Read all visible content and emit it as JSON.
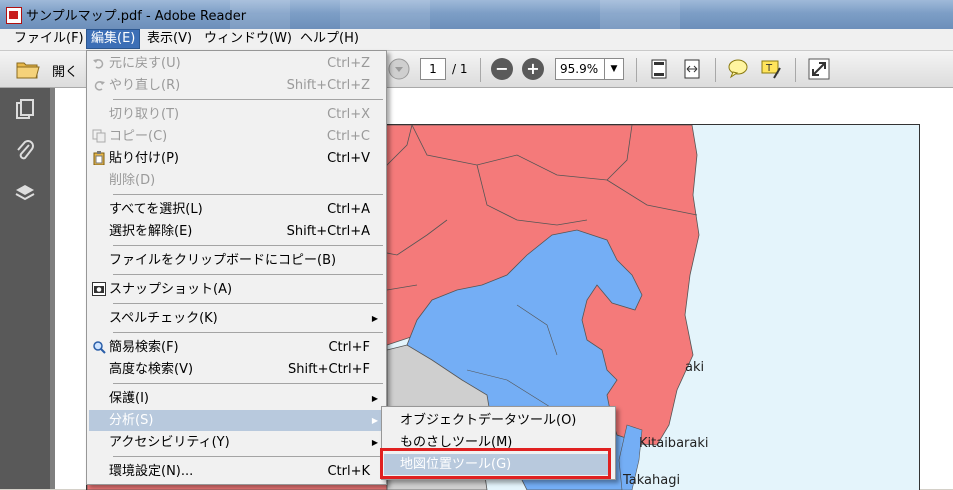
{
  "window": {
    "title": "サンプルマップ.pdf - Adobe Reader"
  },
  "menubar": [
    {
      "label": "ファイル(F)"
    },
    {
      "label": "編集(E)"
    },
    {
      "label": "表示(V)"
    },
    {
      "label": "ウィンドウ(W)"
    },
    {
      "label": "ヘルプ(H)"
    }
  ],
  "toolbar": {
    "open_label": "開く",
    "page_current": "1",
    "page_total": "/ 1",
    "zoom_value": "95.9%"
  },
  "edit_menu": {
    "items": [
      {
        "label": "元に戻す(U)",
        "shortcut": "Ctrl+Z"
      },
      {
        "label": "やり直し(R)",
        "shortcut": "Shift+Ctrl+Z"
      },
      {
        "label": "切り取り(T)",
        "shortcut": "Ctrl+X"
      },
      {
        "label": "コピー(C)",
        "shortcut": "Ctrl+C"
      },
      {
        "label": "貼り付け(P)",
        "shortcut": "Ctrl+V"
      },
      {
        "label": "削除(D)",
        "shortcut": ""
      },
      {
        "label": "すべてを選択(L)",
        "shortcut": "Ctrl+A"
      },
      {
        "label": "選択を解除(E)",
        "shortcut": "Shift+Ctrl+A"
      },
      {
        "label": "ファイルをクリップボードにコピー(B)",
        "shortcut": ""
      },
      {
        "label": "スナップショット(A)",
        "shortcut": ""
      },
      {
        "label": "スペルチェック(K)",
        "shortcut": ""
      },
      {
        "label": "簡易検索(F)",
        "shortcut": "Ctrl+F"
      },
      {
        "label": "高度な検索(V)",
        "shortcut": "Shift+Ctrl+F"
      },
      {
        "label": "保護(I)",
        "shortcut": ""
      },
      {
        "label": "分析(S)",
        "shortcut": ""
      },
      {
        "label": "アクセシビリティ(Y)",
        "shortcut": ""
      },
      {
        "label": "環境設定(N)...",
        "shortcut": "Ctrl+K"
      }
    ]
  },
  "analysis_submenu": {
    "items": [
      {
        "label": "オブジェクトデータツール(O)"
      },
      {
        "label": "ものさしツール(M)"
      },
      {
        "label": "地図位置ツール(G)"
      }
    ]
  },
  "map": {
    "labels": [
      "aki",
      "Kitaibaraki",
      "Takahagi"
    ]
  },
  "colors": {
    "menu_active": "#3d6fb6",
    "menu_highlight": "#b8c9dd",
    "map_red": "#f47a7a",
    "map_blue": "#74aef5",
    "map_gray": "#cfcfcf",
    "sea": "#e4f4fb",
    "callout_border": "#e02020"
  }
}
